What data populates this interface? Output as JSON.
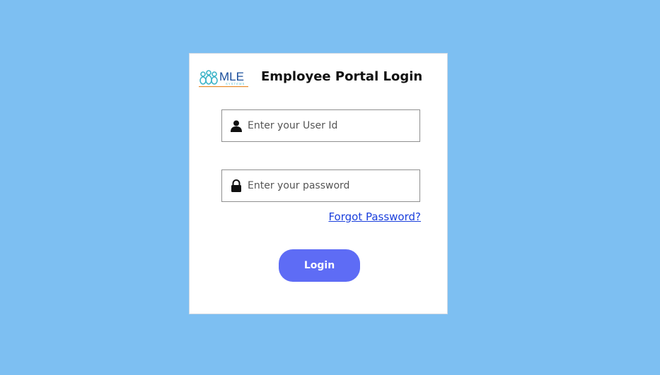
{
  "colors": {
    "background": "#7dbff2",
    "card": "#ffffff",
    "login_button": "#5e6cf5",
    "link": "#1a3fdc",
    "logo_teal": "#3cb4c8",
    "logo_navy": "#1b4f9c",
    "logo_orange": "#e88a2a"
  },
  "logo": {
    "text": "MLE",
    "subtext": "SYSTEMS"
  },
  "header": {
    "title": "Employee Portal Login"
  },
  "form": {
    "user_id": {
      "icon": "user-icon",
      "placeholder": "Enter your User Id",
      "value": ""
    },
    "password": {
      "icon": "lock-icon",
      "placeholder": "Enter your password",
      "value": ""
    },
    "forgot_password_label": "Forgot Password?",
    "login_label": "Login"
  }
}
